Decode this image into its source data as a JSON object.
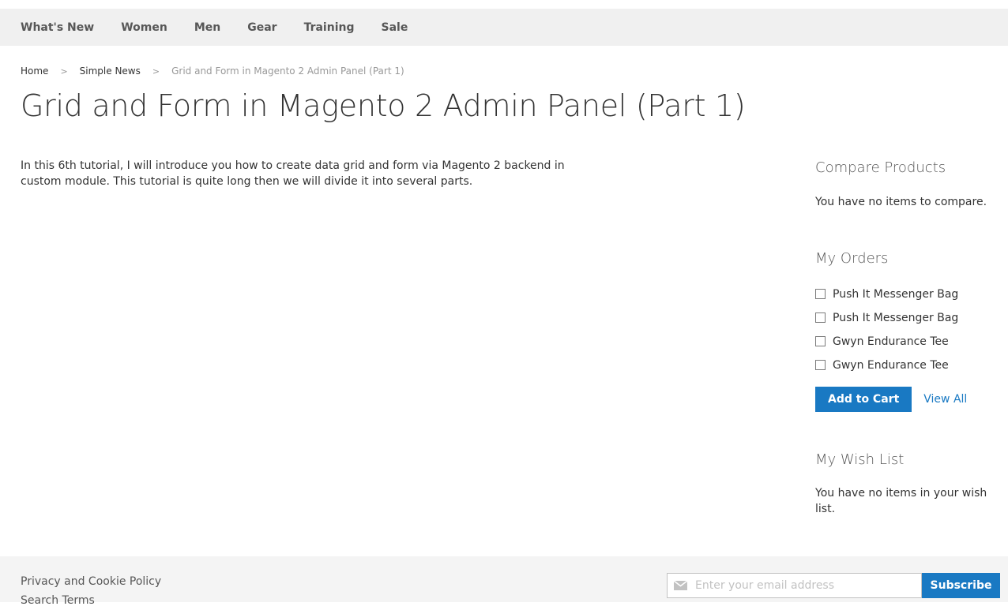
{
  "nav": {
    "items": [
      "What's New",
      "Women",
      "Men",
      "Gear",
      "Training",
      "Sale"
    ]
  },
  "breadcrumbs": {
    "home": "Home",
    "section": "Simple News",
    "current": "Grid and Form in Magento 2 Admin Panel (Part 1)",
    "separator": ">"
  },
  "page": {
    "title": "Grid and Form in Magento 2 Admin Panel (Part 1)",
    "body": "In this 6th tutorial, I will introduce you how to create data grid and form via Magento 2 backend in custom module. This tutorial is quite long then we will divide it into several parts."
  },
  "sidebar": {
    "compare": {
      "title": "Compare Products",
      "text": "You have no items to compare."
    },
    "orders": {
      "title": "My Orders",
      "items": [
        "Push It Messenger Bag",
        "Push It Messenger Bag",
        "Gwyn Endurance Tee",
        "Gwyn Endurance Tee"
      ],
      "add_to_cart": "Add to Cart",
      "view_all": "View All"
    },
    "wishlist": {
      "title": "My Wish List",
      "text": "You have no items in your wish list."
    }
  },
  "footer": {
    "links": [
      "Privacy and Cookie Policy",
      "Search Terms"
    ],
    "newsletter": {
      "placeholder": "Enter your email address",
      "subscribe": "Subscribe",
      "icon": "envelope-icon"
    }
  },
  "colors": {
    "primary": "#1979c3",
    "nav_bg": "#f0f0f0",
    "footer_bg": "#f4f4f4"
  }
}
